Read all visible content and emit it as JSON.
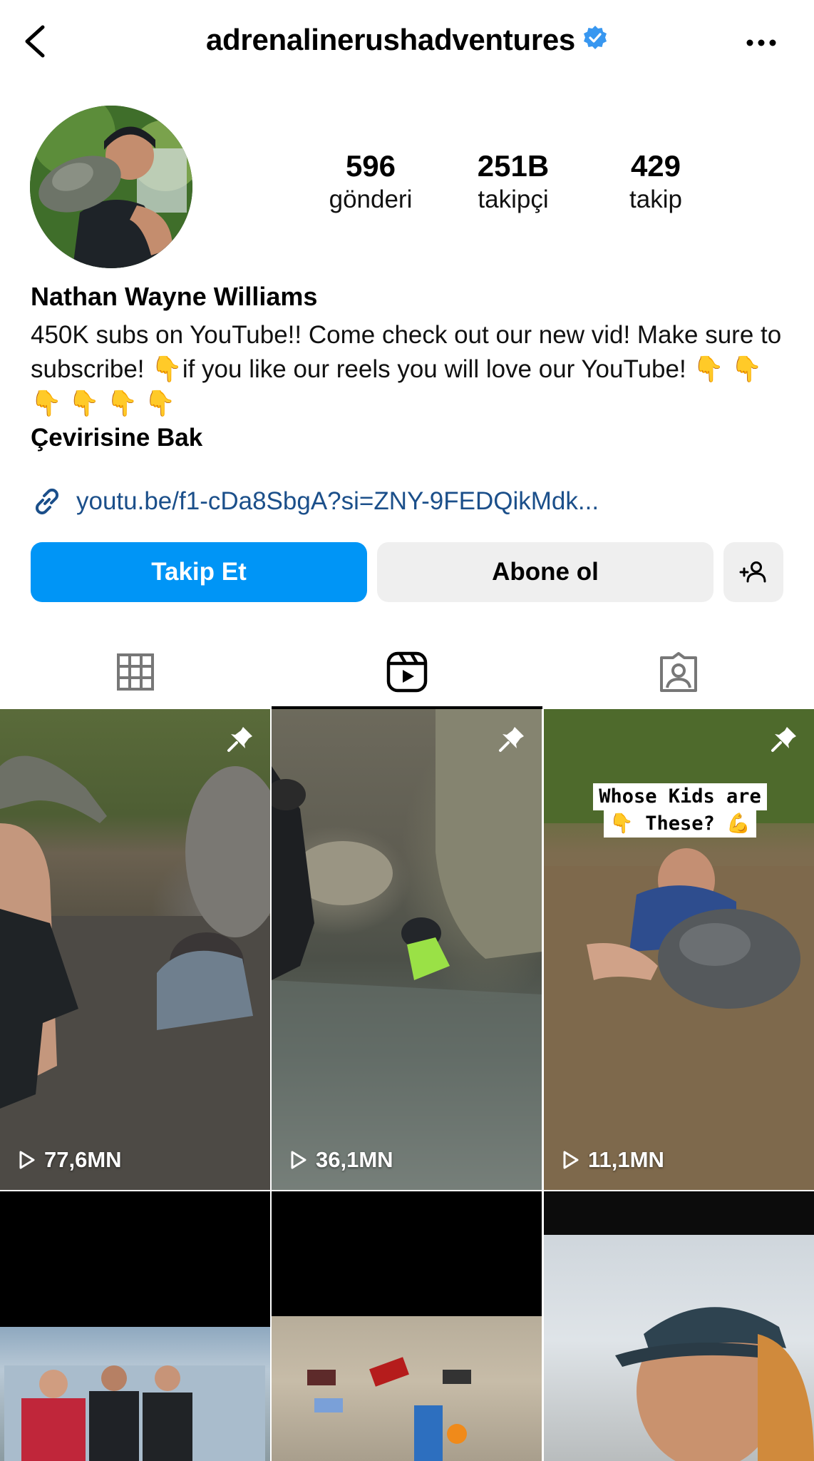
{
  "header": {
    "username": "adrenalinerushadventures",
    "verified": true
  },
  "stats": [
    {
      "value": "596",
      "label": "gönderi"
    },
    {
      "value": "251B",
      "label": "takipçi"
    },
    {
      "value": "429",
      "label": "takip"
    }
  ],
  "profile": {
    "name": "Nathan Wayne Williams",
    "bio": "450K subs on YouTube!! Come check out our new vid! Make sure to subscribe! 👇if you like our reels you will love our YouTube! 👇 👇 👇 👇 👇 👇",
    "translate_label": "Çevirisine Bak",
    "link": "youtu.be/f1-cDa8SbgA?si=ZNY-9FEDQikMdk..."
  },
  "actions": {
    "follow_label": "Takip Et",
    "subscribe_label": "Abone ol"
  },
  "tabs": [
    {
      "name": "grid",
      "icon": "grid-icon",
      "active": false
    },
    {
      "name": "reels",
      "icon": "reels-icon",
      "active": true
    },
    {
      "name": "tagged",
      "icon": "tagged-icon",
      "active": false
    }
  ],
  "reels": [
    {
      "views": "77,6MN",
      "pinned": true
    },
    {
      "views": "36,1MN",
      "pinned": true
    },
    {
      "views": "11,1MN",
      "pinned": true,
      "caption_line1": "Whose Kids are",
      "caption_line2": "👇 These? 💪"
    },
    {
      "pinned": false
    },
    {
      "pinned": false
    },
    {
      "pinned": false
    }
  ],
  "colors": {
    "primary_button": "#0095f6",
    "secondary_button": "#efefef",
    "verified_badge": "#3897f0",
    "link": "#1b4f8a"
  }
}
